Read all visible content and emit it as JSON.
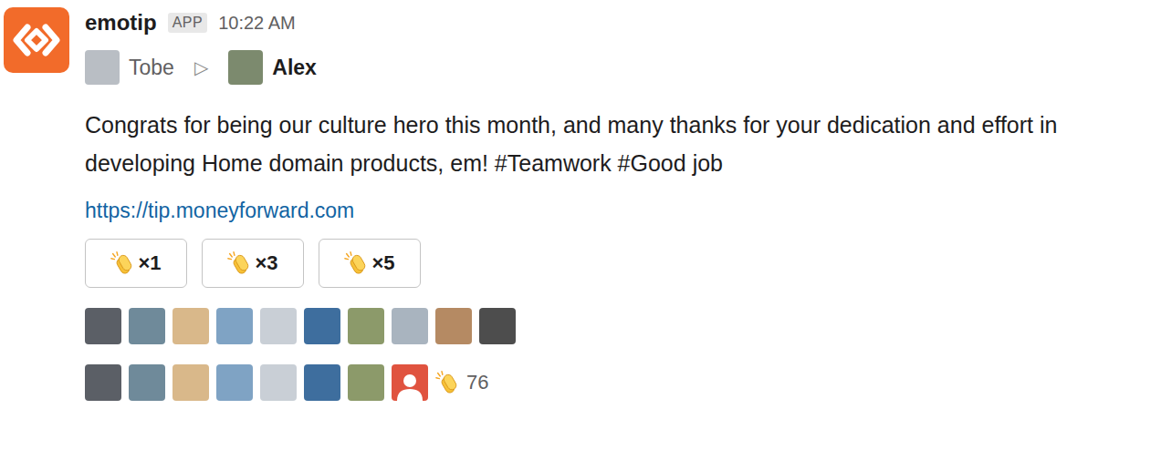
{
  "app": {
    "name": "emotip",
    "badge": "APP",
    "time": "10:22 AM"
  },
  "transfer": {
    "from": "Tobe",
    "arrow": "▷",
    "to": "Alex"
  },
  "message": {
    "text": "Congrats for being our culture hero this month, and many thanks for your dedication and effort in developing Home domain products, em! #Teamwork #Good job",
    "link": "https://tip.moneyforward.com"
  },
  "tip_buttons": [
    {
      "label": "×1"
    },
    {
      "label": "×3"
    },
    {
      "label": "×5"
    }
  ],
  "reactor_rows": [
    [
      {
        "kind": "photo"
      },
      {
        "kind": "photo"
      },
      {
        "kind": "photo"
      },
      {
        "kind": "photo"
      },
      {
        "kind": "photo"
      },
      {
        "kind": "photo"
      },
      {
        "kind": "photo"
      },
      {
        "kind": "photo"
      },
      {
        "kind": "photo"
      },
      {
        "kind": "photo"
      }
    ],
    [
      {
        "kind": "photo"
      },
      {
        "kind": "photo"
      },
      {
        "kind": "photo"
      },
      {
        "kind": "photo"
      },
      {
        "kind": "photo"
      },
      {
        "kind": "photo"
      },
      {
        "kind": "photo"
      },
      {
        "kind": "default"
      }
    ]
  ],
  "reaction_count": "76"
}
